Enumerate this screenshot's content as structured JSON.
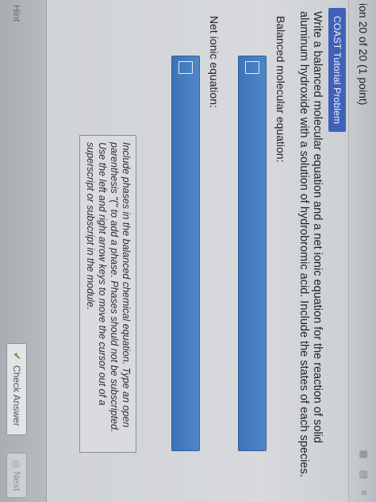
{
  "header": {
    "question_number": "ion 20 of 20 (1 point)"
  },
  "tutorial": {
    "badge": "COAST Tutorial Problem"
  },
  "problem": {
    "prompt": "Write a balanced molecular equation and a net ionic equation for the reaction of solid aluminum hydroxide with a solution of hydrobromic acid. Include the states of each species.",
    "molecular_label": "Balanced molecular equation:",
    "net_label": "Net ionic equation:",
    "hint": "Include phases in the balanced chemical equation. Type an open parenthesis \"(\" to add a phase. Phases should not be subscripted. Use the left and right arrow keys to move the cursor out of a superscript or subscript in the module."
  },
  "footer": {
    "hint_link": "Hint",
    "check_answer": "Check Answer",
    "next": "Next"
  },
  "colors": {
    "badge": "#3f61b8",
    "answer_box": "#4a80c2"
  }
}
